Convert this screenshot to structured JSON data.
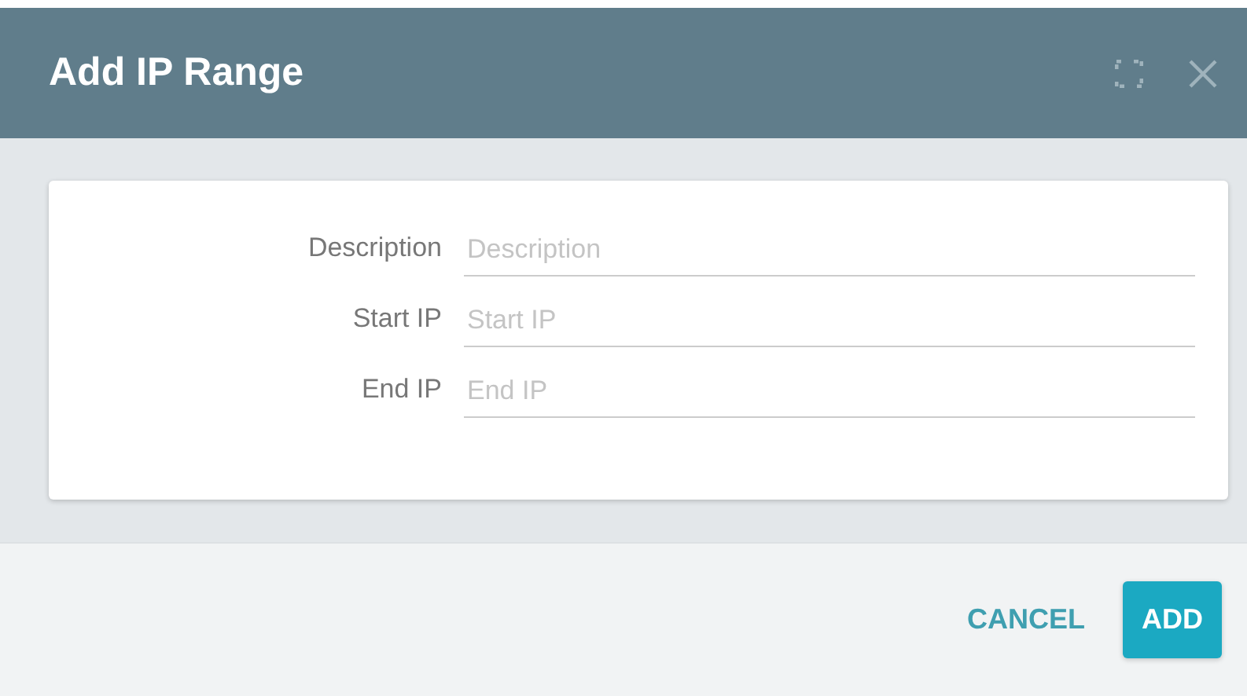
{
  "dialog": {
    "title": "Add IP Range"
  },
  "fields": [
    {
      "label": "Description",
      "placeholder": "Description"
    },
    {
      "label": "Start IP",
      "placeholder": "Start IP"
    },
    {
      "label": "End IP",
      "placeholder": "End IP"
    }
  ],
  "buttons": [
    {
      "label": "CANCEL",
      "kind": "text"
    },
    {
      "label": "ADD",
      "kind": "primary"
    }
  ]
}
